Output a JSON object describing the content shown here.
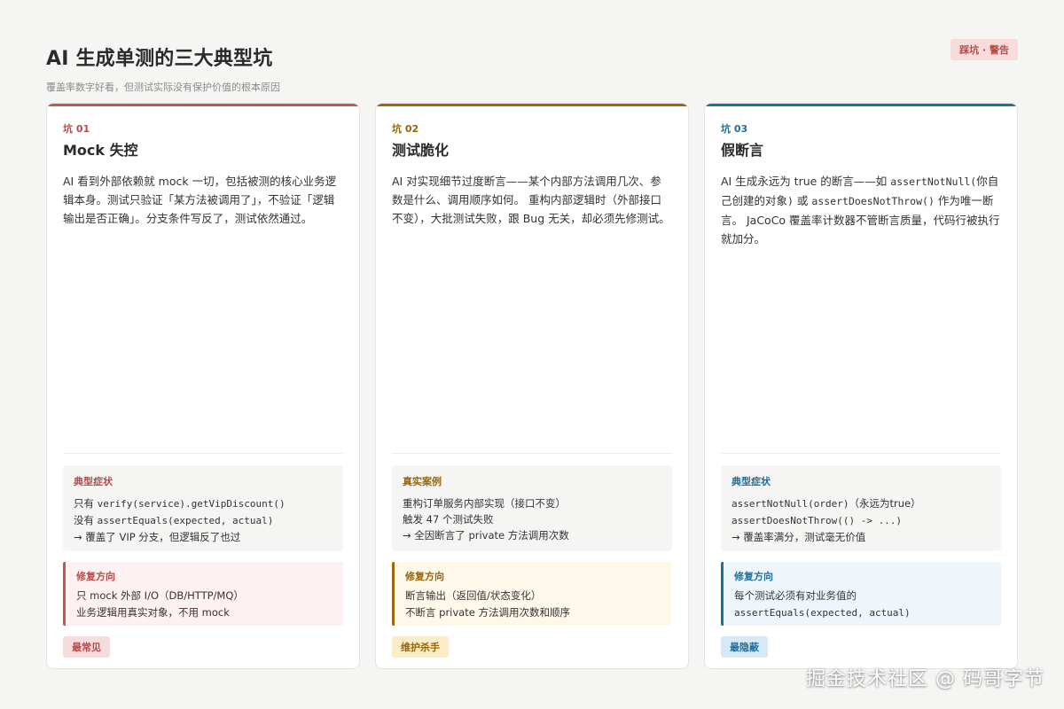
{
  "header": {
    "title": "AI 生成单测的三大典型坑",
    "subtitle": "覆盖率数字好看，但测试实际没有保护价值的根本原因",
    "badge": "踩坑 · 警告"
  },
  "cards": [
    {
      "tag": "坑 01",
      "title": "Mock 失控",
      "desc": "AI 看到外部依赖就 mock 一切，包括被测的核心业务逻辑本身。测试只验证「某方法被调用了」，不验证「逻辑输出是否正确」。分支条件写反了，测试依然通过。",
      "symptom_title": "典型症状",
      "symptom_lines": [
        {
          "pre": "只有 ",
          "code": "verify(service).getVipDiscount()",
          "post": ""
        },
        {
          "pre": "没有 ",
          "code": "assertEquals(expected, actual)",
          "post": ""
        },
        {
          "pre": "→ 覆盖了 VIP 分支，但逻辑反了也过",
          "code": "",
          "post": ""
        }
      ],
      "fix_title": "修复方向",
      "fix_lines": [
        {
          "pre": "只 mock 外部 I/O（DB/HTTP/MQ）",
          "code": ""
        },
        {
          "pre": "业务逻辑用真实对象，不用 mock",
          "code": ""
        }
      ],
      "badge": "最常见",
      "color": "#c0574f"
    },
    {
      "tag": "坑 02",
      "title": "测试脆化",
      "desc": "AI 对实现细节过度断言——某个内部方法调用几次、参数是什么、调用顺序如何。 重构内部逻辑时（外部接口不变），大批测试失败，跟 Bug 无关，却必须先修测试。",
      "symptom_title": "真实案例",
      "symptom_lines": [
        {
          "pre": "重构订单服务内部实现（接口不变）",
          "code": "",
          "post": ""
        },
        {
          "pre": "触发 47 个测试失败",
          "code": "",
          "post": ""
        },
        {
          "pre": "→ 全因断言了 private 方法调用次数",
          "code": "",
          "post": ""
        }
      ],
      "fix_title": "修复方向",
      "fix_lines": [
        {
          "pre": "断言输出（返回值/状态变化）",
          "code": ""
        },
        {
          "pre": "不断言 private 方法调用次数和顺序",
          "code": ""
        }
      ],
      "badge": "维护杀手",
      "color": "#9b6a08"
    },
    {
      "tag": "坑 03",
      "title": "假断言",
      "desc_parts": [
        {
          "t": "AI 生成永远为 true 的断言——如 ",
          "code": false
        },
        {
          "t": "assertNotNull(",
          "code": true
        },
        {
          "t": "你自己创建的对象",
          "code": false
        },
        {
          "t": ")",
          "code": true
        },
        {
          "t": " 或 ",
          "code": false
        },
        {
          "t": "assertDoesNotThrow()",
          "code": true
        },
        {
          "t": " 作为唯一断言。 JaCoCo 覆盖率计数器不管断言质量，代码行被执行就加分。",
          "code": false
        }
      ],
      "symptom_title": "典型症状",
      "symptom_lines": [
        {
          "pre": "",
          "code": "assertNotNull(order)",
          "post": "（永远为true）"
        },
        {
          "pre": "",
          "code": "assertDoesNotThrow(() -> ...)",
          "post": ""
        },
        {
          "pre": "→ 覆盖率满分，测试毫无价值",
          "code": "",
          "post": ""
        }
      ],
      "fix_title": "修复方向",
      "fix_lines": [
        {
          "pre": "每个测试必须有对业务值的",
          "code": ""
        },
        {
          "pre": "",
          "code": "assertEquals(expected, actual)"
        }
      ],
      "badge": "最隐蔽",
      "color": "#1f6f9c"
    }
  ],
  "watermark": "掘金技术社区 @ 码哥字节"
}
